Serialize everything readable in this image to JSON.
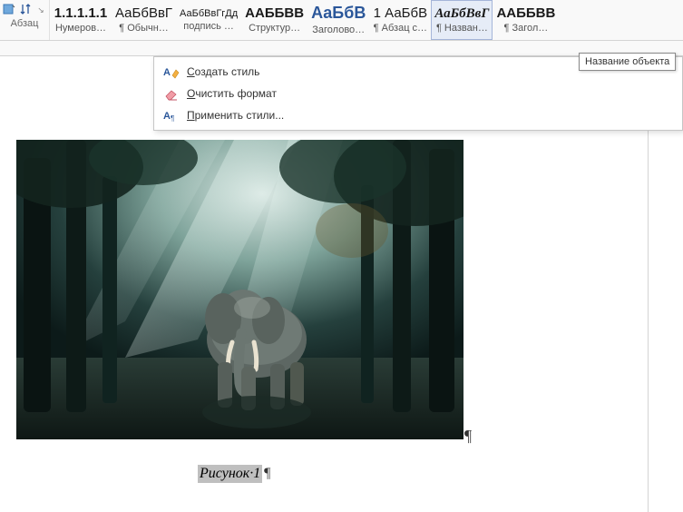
{
  "paragraph": {
    "label": "Абзац"
  },
  "styles": [
    {
      "preview": "1.1.1.1.1",
      "name": "Нумеров…",
      "cls": "bold"
    },
    {
      "preview": "АаБбВвГ",
      "name": "¶ Обычн…",
      "cls": ""
    },
    {
      "preview": "АаБбВвГгДд",
      "name": "подпись …",
      "cls": "small"
    },
    {
      "preview": "ААББВВ",
      "name": "Структур…",
      "cls": "bold"
    },
    {
      "preview": "АаБбВ",
      "name": "Заголово…",
      "cls": "bold blue",
      "size": "18px"
    },
    {
      "preview": "1 АаБбВ",
      "name": "¶ Абзац с…",
      "cls": ""
    },
    {
      "preview": "АаБбВвГ",
      "name": "¶ Назван…",
      "cls": "italic",
      "selected": true
    },
    {
      "preview": "ААББВВ",
      "name": "¶ Загол…",
      "cls": "bold"
    }
  ],
  "tooltip": "Название объекта",
  "dropdown": {
    "create": "Создать стиль",
    "clear": "Очистить формат",
    "apply": "Применить стили..."
  },
  "caption": {
    "text": "Рисунок·1",
    "pilcrow": "¶"
  },
  "pilcrow_after_image": "¶"
}
